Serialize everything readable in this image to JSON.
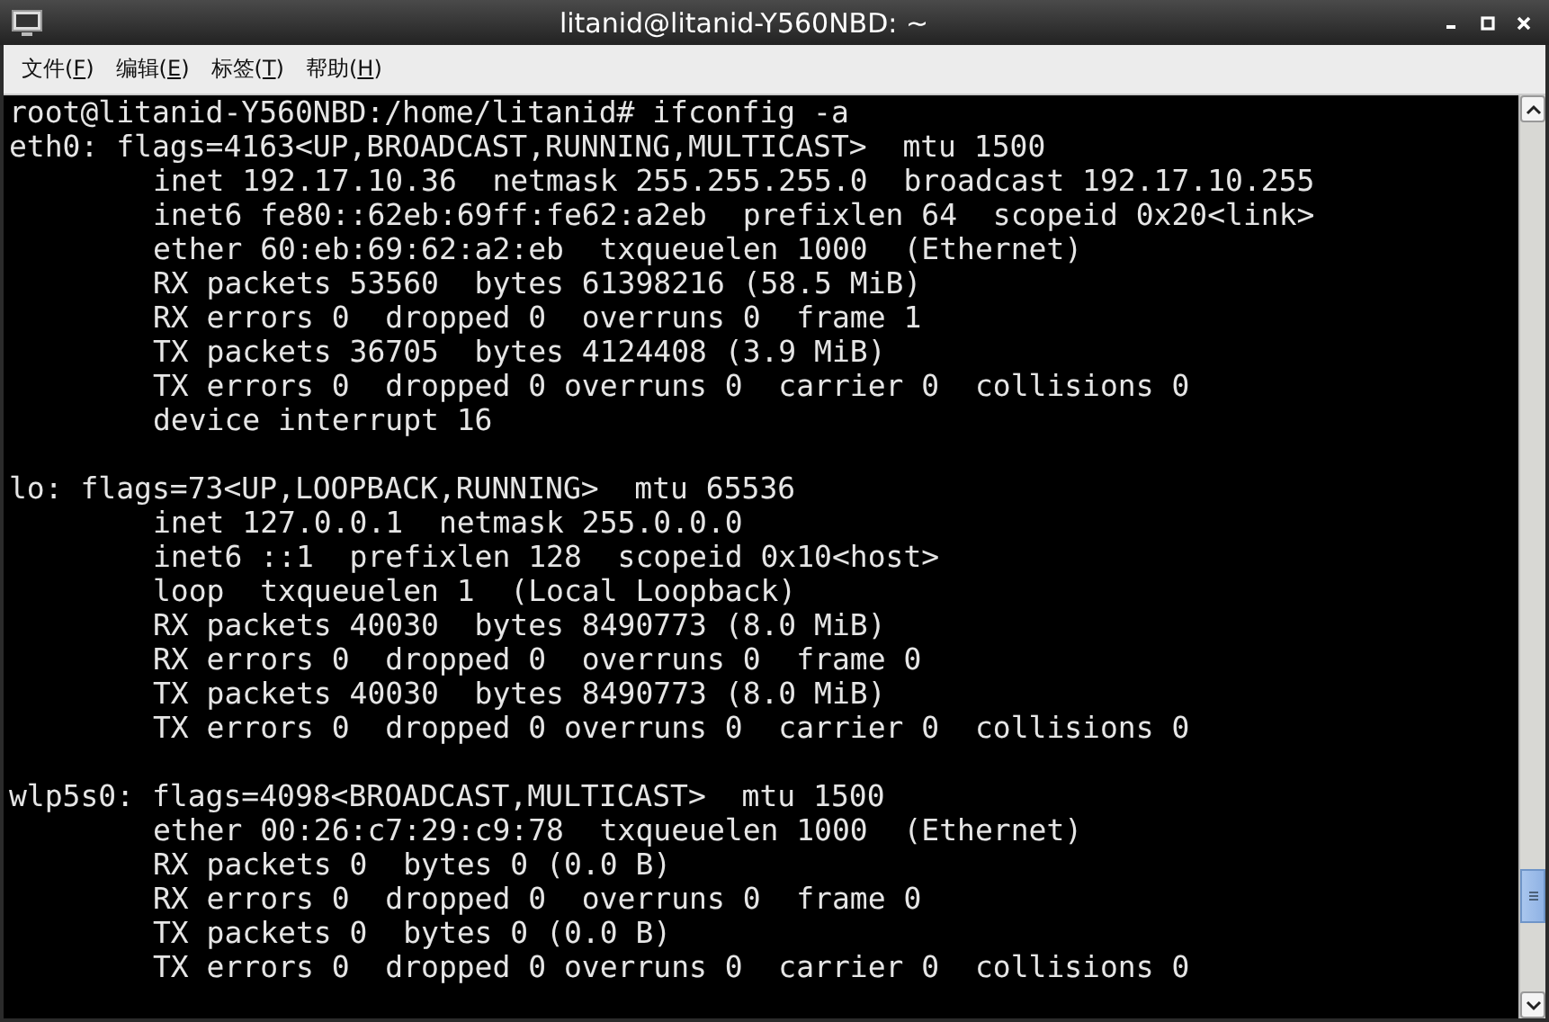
{
  "window": {
    "title": "litanid@litanid-Y560NBD: ~"
  },
  "menu": [
    {
      "label": "文件(",
      "access_key": "F",
      "label_end": ")"
    },
    {
      "label": "编辑(",
      "access_key": "E",
      "label_end": ")"
    },
    {
      "label": "标签(",
      "access_key": "T",
      "label_end": ")"
    },
    {
      "label": "帮助(",
      "access_key": "H",
      "label_end": ")"
    }
  ],
  "terminal": {
    "command_line": "root@litanid-Y560NBD:/home/litanid# ifconfig -a",
    "interfaces": [
      {
        "header": "eth0: flags=4163<UP,BROADCAST,RUNNING,MULTICAST>  mtu 1500",
        "lines": [
          "inet 192.17.10.36  netmask 255.255.255.0  broadcast 192.17.10.255",
          "inet6 fe80::62eb:69ff:fe62:a2eb  prefixlen 64  scopeid 0x20<link>",
          "ether 60:eb:69:62:a2:eb  txqueuelen 1000  (Ethernet)",
          "RX packets 53560  bytes 61398216 (58.5 MiB)",
          "RX errors 0  dropped 0  overruns 0  frame 1",
          "TX packets 36705  bytes 4124408 (3.9 MiB)",
          "TX errors 0  dropped 0 overruns 0  carrier 0  collisions 0",
          "device interrupt 16"
        ]
      },
      {
        "header": "lo: flags=73<UP,LOOPBACK,RUNNING>  mtu 65536",
        "lines": [
          "inet 127.0.0.1  netmask 255.0.0.0",
          "inet6 ::1  prefixlen 128  scopeid 0x10<host>",
          "loop  txqueuelen 1  (Local Loopback)",
          "RX packets 40030  bytes 8490773 (8.0 MiB)",
          "RX errors 0  dropped 0  overruns 0  frame 0",
          "TX packets 40030  bytes 8490773 (8.0 MiB)",
          "TX errors 0  dropped 0 overruns 0  carrier 0  collisions 0"
        ]
      },
      {
        "header": "wlp5s0: flags=4098<BROADCAST,MULTICAST>  mtu 1500",
        "lines": [
          "ether 00:26:c7:29:c9:78  txqueuelen 1000  (Ethernet)",
          "RX packets 0  bytes 0 (0.0 B)",
          "RX errors 0  dropped 0  overruns 0  frame 0",
          "TX packets 0  bytes 0 (0.0 B)",
          "TX errors 0  dropped 0 overruns 0  carrier 0  collisions 0"
        ]
      }
    ]
  }
}
